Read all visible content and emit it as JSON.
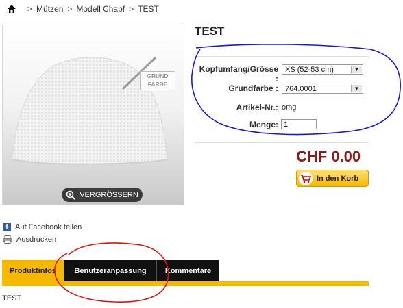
{
  "breadcrumb": {
    "separator": ">",
    "items": [
      "Mützen",
      "Modell Chapf",
      "TEST"
    ]
  },
  "product": {
    "title": "TEST",
    "image_overlay_text": "GRUND FARBE",
    "zoom_label": "VERGRÖSSERN",
    "options": [
      {
        "label": "Kopfumfang/Grösse :",
        "value": "XS (52-53 cm)"
      },
      {
        "label": "Grundfarbe :",
        "value": "764.0001"
      }
    ],
    "article": {
      "label": "Artikel-Nr.:",
      "value": "omg"
    },
    "quantity": {
      "label": "Menge:",
      "value": "1"
    },
    "price": "CHF 0.00",
    "cart_button": "In den Korb"
  },
  "social": {
    "facebook": "Auf Facebook teilen",
    "print": "Ausdrucken"
  },
  "tabs": [
    {
      "label": "Produktinfos",
      "active": true
    },
    {
      "label": "Benutzeranpassung",
      "active": false
    },
    {
      "label": "Kommentare",
      "active": false
    }
  ],
  "tab_content": "TEST",
  "colors": {
    "accent": "#f6b900",
    "price": "#8b1a1a",
    "annotation_blue": "#1a1acc",
    "annotation_red": "#dd1111"
  }
}
